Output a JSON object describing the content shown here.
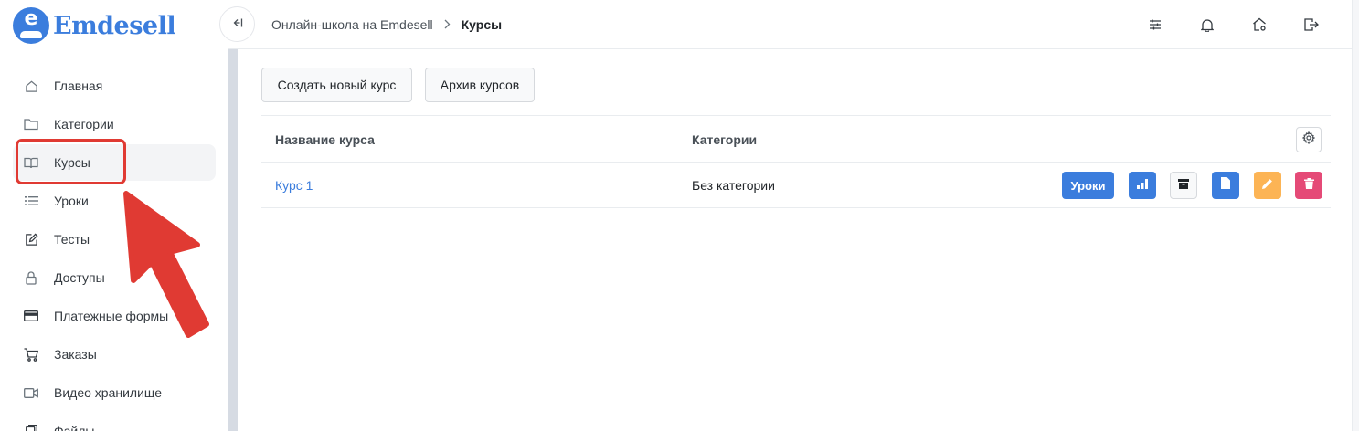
{
  "app": {
    "logo_letter": "e",
    "name": "Emdesell",
    "brand_color": "#3b7ddd"
  },
  "sidebar": {
    "items": [
      {
        "label": "Главная",
        "icon": "home-icon"
      },
      {
        "label": "Категории",
        "icon": "folder-icon"
      },
      {
        "label": "Курсы",
        "icon": "book-icon",
        "active": true
      },
      {
        "label": "Уроки",
        "icon": "list-icon"
      },
      {
        "label": "Тесты",
        "icon": "edit-icon"
      },
      {
        "label": "Доступы",
        "icon": "lock-icon"
      },
      {
        "label": "Платежные формы",
        "icon": "credit-card-icon"
      },
      {
        "label": "Заказы",
        "icon": "cart-icon"
      },
      {
        "label": "Видео хранилище",
        "icon": "video-icon"
      },
      {
        "label": "Файлы",
        "icon": "file-icon"
      }
    ]
  },
  "header": {
    "collapse_icon": "collapse-sidebar-icon",
    "breadcrumbs": [
      "Онлайн-школа на Emdesell",
      "Курсы"
    ],
    "breadcrumb_separator": ">",
    "icons": [
      "sliders-icon",
      "bell-icon",
      "home-settings-icon",
      "logout-icon"
    ]
  },
  "toolbar": {
    "create_label": "Создать новый курс",
    "archive_label": "Архив курсов"
  },
  "table": {
    "columns": [
      "Название курса",
      "Категории"
    ],
    "settings_icon": "gear-icon",
    "rows": [
      {
        "name": "Курс 1",
        "category": "Без категории",
        "actions": {
          "lessons_label": "Уроки",
          "icons": [
            "stats-icon",
            "archive-icon",
            "document-icon",
            "pencil-icon",
            "trash-icon"
          ]
        }
      }
    ]
  },
  "colors": {
    "primary": "#3b7ddd",
    "warning": "#fcb455",
    "danger": "#e54a77",
    "annotation": "#e03a33"
  }
}
